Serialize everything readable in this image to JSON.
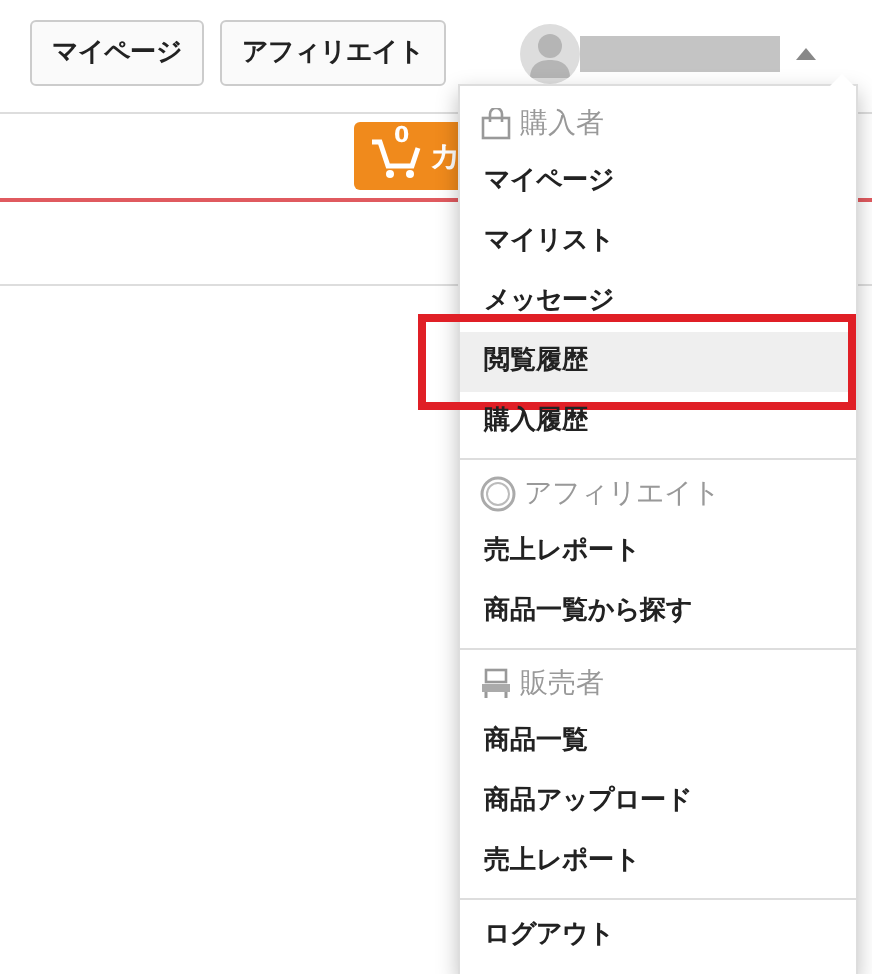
{
  "top_buttons": [
    {
      "label": "マイページ"
    },
    {
      "label": "アフィリエイト"
    }
  ],
  "cart": {
    "count": "0",
    "label": "カ"
  },
  "menu": {
    "sections": [
      {
        "header": "購入者",
        "kind": "bag",
        "items": [
          {
            "label": "マイページ",
            "selected": false,
            "callout": false
          },
          {
            "label": "マイリスト",
            "selected": false,
            "callout": false
          },
          {
            "label": "メッセージ",
            "selected": false,
            "callout": false
          },
          {
            "label": "閲覧履歴",
            "selected": true,
            "callout": true
          },
          {
            "label": "購入履歴",
            "selected": false,
            "callout": false
          }
        ]
      },
      {
        "header": "アフィリエイト",
        "kind": "fc2",
        "items": [
          {
            "label": "売上レポート",
            "selected": false,
            "callout": false
          },
          {
            "label": "商品一覧から探す",
            "selected": false,
            "callout": false
          }
        ]
      },
      {
        "header": "販売者",
        "kind": "seller",
        "items": [
          {
            "label": "商品一覧",
            "selected": false,
            "callout": false
          },
          {
            "label": "商品アップロード",
            "selected": false,
            "callout": false
          },
          {
            "label": "売上レポート",
            "selected": false,
            "callout": false
          }
        ]
      },
      {
        "items": [
          {
            "label": "ログアウト",
            "selected": false,
            "callout": false
          }
        ]
      }
    ]
  }
}
